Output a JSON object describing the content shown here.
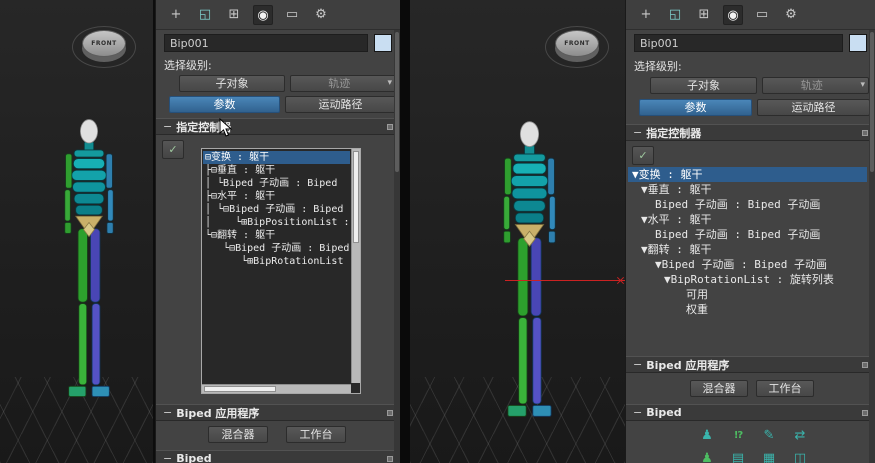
{
  "ui": {
    "collapse_glyph": "−",
    "dropdown_glyph": "▾",
    "assign_button_glyph": "✓",
    "viewport_gizmo_label": "FRONT"
  },
  "accent_colors": {
    "selection_blue": "#2e5d8d",
    "active_button_blue": "#3a6e9e",
    "object_color_swatch": "#c9def2",
    "axis_red": "#cc2222",
    "icon_teal": "#3ab4ac",
    "icon_green": "#4dbd62"
  },
  "toolbar": {
    "icons": [
      {
        "name": "create-tab",
        "glyph": "+"
      },
      {
        "name": "modify-tab",
        "glyph": "◱"
      },
      {
        "name": "hierarchy-tab",
        "glyph": "⊞"
      },
      {
        "name": "motion-tab",
        "glyph": "◉",
        "active": true
      },
      {
        "name": "display-tab",
        "glyph": "▭"
      },
      {
        "name": "utilities-tab",
        "glyph": "⚙"
      }
    ]
  },
  "panel": {
    "object_name": "Bip001",
    "selection_level_label": "选择级别:",
    "sub_object_button": "子对象",
    "trajectory_button": "轨迹",
    "parameters_button": "参数",
    "motion_paths_button": "运动路径",
    "assign_controller_rollout": "指定控制器",
    "biped_apps_rollout": "Biped 应用程序",
    "mixer_button": "混合器",
    "workbench_button": "工作台",
    "biped_rollout": "Biped"
  },
  "left_tree": {
    "items": [
      {
        "text": "⊟变换 : 躯干",
        "selected": true
      },
      {
        "text": "├⊟垂直 : 躯干",
        "selected": false
      },
      {
        "text": "│ └Biped 子动画 : Biped",
        "selected": false
      },
      {
        "text": "├⊟水平 : 躯干",
        "selected": false
      },
      {
        "text": "│ └⊟Biped 子动画 : Biped",
        "selected": false
      },
      {
        "text": "│    └⊞BipPositionList :",
        "selected": false
      },
      {
        "text": "└⊟翻转 : 躯干",
        "selected": false
      },
      {
        "text": "   └⊟Biped 子动画 : Biped",
        "selected": false
      },
      {
        "text": "      └⊞BipRotationList :",
        "selected": false
      }
    ]
  },
  "right_tree": {
    "items": [
      {
        "text": "▼变换 : 躯干",
        "selected": true
      },
      {
        "text": "▼垂直 : 躯干",
        "selected": false
      },
      {
        "text": "Biped 子动画 : Biped 子动画",
        "selected": false
      },
      {
        "text": "▼水平 : 躯干",
        "selected": false
      },
      {
        "text": "Biped 子动画 : Biped 子动画",
        "selected": false
      },
      {
        "text": "▼翻转 : 躯干",
        "selected": false
      },
      {
        "text": "▼Biped 子动画 : Biped 子动画",
        "selected": false
      },
      {
        "text": "▼BipRotationList : 旋转列表",
        "selected": false
      },
      {
        "text": "可用",
        "selected": false
      },
      {
        "text": "权重",
        "selected": false
      }
    ]
  },
  "biped_icons": {
    "row1": [
      {
        "name": "figure-mode-icon",
        "glyph": "♟"
      },
      {
        "name": "footstep-mode-icon",
        "glyph": "!?"
      },
      {
        "name": "motion-flow-mode-icon",
        "glyph": "✎"
      },
      {
        "name": "mixer-mode-icon",
        "glyph": "⇄"
      }
    ],
    "row2": [
      {
        "name": "biped-figure-files-icon",
        "glyph": "♟"
      },
      {
        "name": "load-file-icon",
        "glyph": "▤"
      },
      {
        "name": "save-file-icon",
        "glyph": "▦"
      },
      {
        "name": "convert-icon",
        "glyph": "◫"
      }
    ]
  }
}
